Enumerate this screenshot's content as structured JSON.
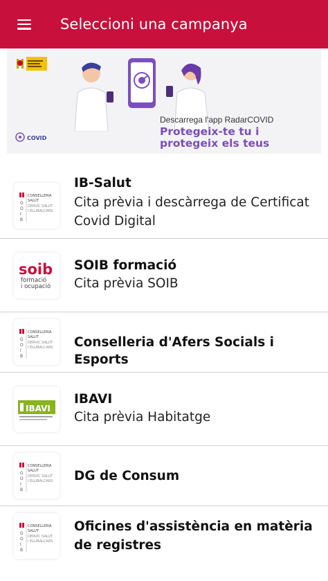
{
  "appbar": {
    "title": "Seleccioni una campanya",
    "menu_icon": "hamburger-menu-icon",
    "color": "#c7103c"
  },
  "banner": {
    "download_text": "Descarrega l'app RadarCOVID",
    "slogan": "Protegeix-te tu i protegeix els teus",
    "radar_logo_text": "COVID",
    "slogan_color": "#7a4fb5"
  },
  "logos": {
    "conselleria": "CONSELLERIA SALUT DERVIC SALUT I ELLIBALCARS",
    "soib_main": "soib",
    "soib_sub": "formació i ocupació",
    "ibavi": "IBAVI"
  },
  "campaigns": [
    {
      "name": "IB-Salut",
      "subtitle": "Cita prèvia i descàrrega de Certificat Covid Digital",
      "logo": "conselleria"
    },
    {
      "name": "SOIB formació",
      "subtitle": "Cita prèvia SOIB",
      "logo": "soib"
    },
    {
      "name": "Conselleria d'Afers Socials i Esports",
      "subtitle": "",
      "logo": "conselleria"
    },
    {
      "name": "IBAVI",
      "subtitle": "Cita prèvia Habitatge",
      "logo": "ibavi"
    },
    {
      "name": "DG de Consum",
      "subtitle": "",
      "logo": "conselleria"
    },
    {
      "name": "Oficines d'assistència en matèria de registres",
      "subtitle": "",
      "logo": "conselleria"
    }
  ]
}
